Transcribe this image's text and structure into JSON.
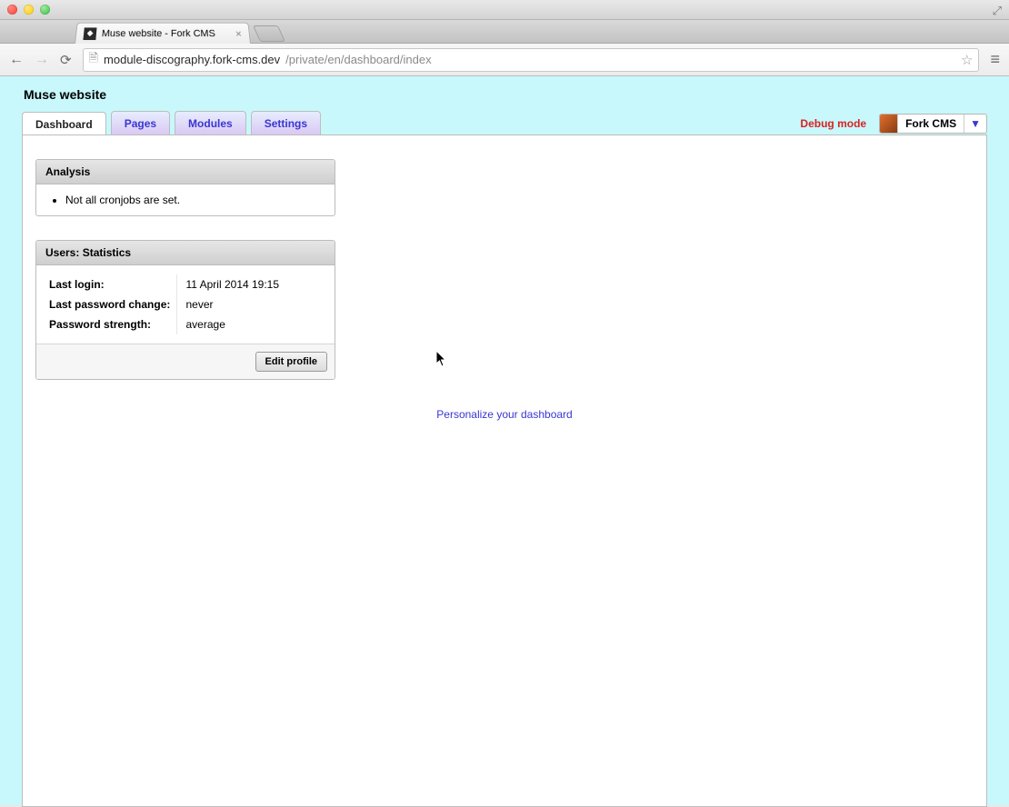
{
  "browser": {
    "tab_title": "Muse website - Fork CMS",
    "url_host": "module-discography.fork-cms.dev",
    "url_path": "/private/en/dashboard/index"
  },
  "header": {
    "site_title": "Muse website",
    "tabs": [
      {
        "label": "Dashboard",
        "active": true
      },
      {
        "label": "Pages",
        "active": false
      },
      {
        "label": "Modules",
        "active": false
      },
      {
        "label": "Settings",
        "active": false
      }
    ],
    "debug_label": "Debug mode",
    "user_label": "Fork CMS",
    "caret": "▼"
  },
  "analysis": {
    "title": "Analysis",
    "items": [
      "Not all cronjobs are set."
    ]
  },
  "stats": {
    "title": "Users: Statistics",
    "rows": [
      {
        "label": "Last login:",
        "value": "11 April 2014 19:15"
      },
      {
        "label": "Last password change:",
        "value": "never"
      },
      {
        "label": "Password strength:",
        "value": "average"
      }
    ],
    "edit_label": "Edit profile"
  },
  "personalize_label": "Personalize your dashboard"
}
